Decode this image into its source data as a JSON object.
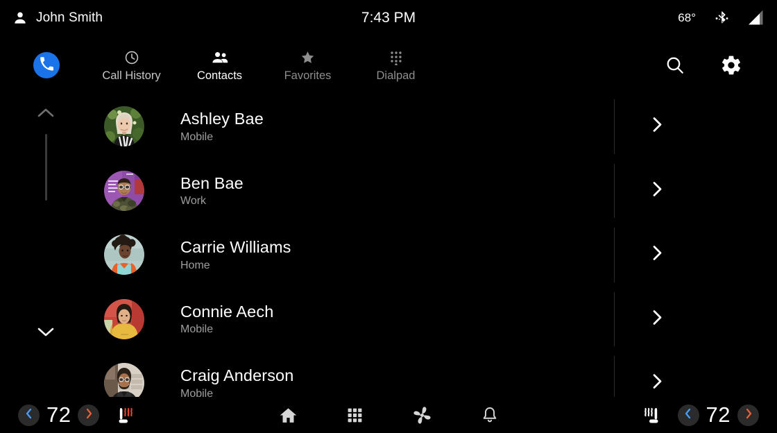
{
  "status_bar": {
    "user_icon": "person-icon",
    "user_name": "John Smith",
    "clock": "7:43 PM",
    "temperature": "68°",
    "bluetooth_icon": "bluetooth-icon",
    "signal_icon": "signal-bars-icon"
  },
  "tab_bar": {
    "app_badge_icon": "phone-handset-icon",
    "tabs": [
      {
        "label": "Call History",
        "icon": "clock-icon",
        "state": "inactive"
      },
      {
        "label": "Contacts",
        "icon": "people-icon",
        "state": "active"
      },
      {
        "label": "Favorites",
        "icon": "star-icon",
        "state": "dimmed"
      },
      {
        "label": "Dialpad",
        "icon": "dialpad-icon",
        "state": "dimmed"
      }
    ],
    "actions": [
      {
        "name": "search-icon"
      },
      {
        "name": "settings-gear-icon"
      }
    ]
  },
  "contact_list": {
    "scroll_up_icon": "chevron-up-icon",
    "scroll_down_icon": "chevron-down-icon",
    "row_chevron_icon": "chevron-right-icon",
    "contacts": [
      {
        "name": "Ashley Bae",
        "type": "Mobile",
        "avatar": "photo-woman-blonde-green"
      },
      {
        "name": "Ben Bae",
        "type": "Work",
        "avatar": "photo-man-camo-purple"
      },
      {
        "name": "Carrie Williams",
        "type": "Home",
        "avatar": "photo-woman-orange-teal"
      },
      {
        "name": "Connie Aech",
        "type": "Mobile",
        "avatar": "photo-woman-yellow-red"
      },
      {
        "name": "Craig Anderson",
        "type": "Mobile",
        "avatar": "photo-man-beard-brick"
      }
    ]
  },
  "bottom_bar": {
    "left_temp": {
      "value": "72",
      "decrease_icon": "chevron-left-icon",
      "increase_icon": "chevron-right-icon",
      "decrease_color": "#4a9eff",
      "increase_color": "#e8633a"
    },
    "left_seat_icon": "heated-seat-icon",
    "center_icons": [
      {
        "name": "home-icon"
      },
      {
        "name": "apps-grid-icon"
      },
      {
        "name": "climate-fan-icon"
      },
      {
        "name": "notification-bell-icon"
      }
    ],
    "right_seat_icon": "ventilated-seat-icon",
    "right_temp": {
      "value": "72",
      "decrease_icon": "chevron-left-icon",
      "increase_icon": "chevron-right-icon",
      "decrease_color": "#4a9eff",
      "increase_color": "#e8633a"
    }
  }
}
